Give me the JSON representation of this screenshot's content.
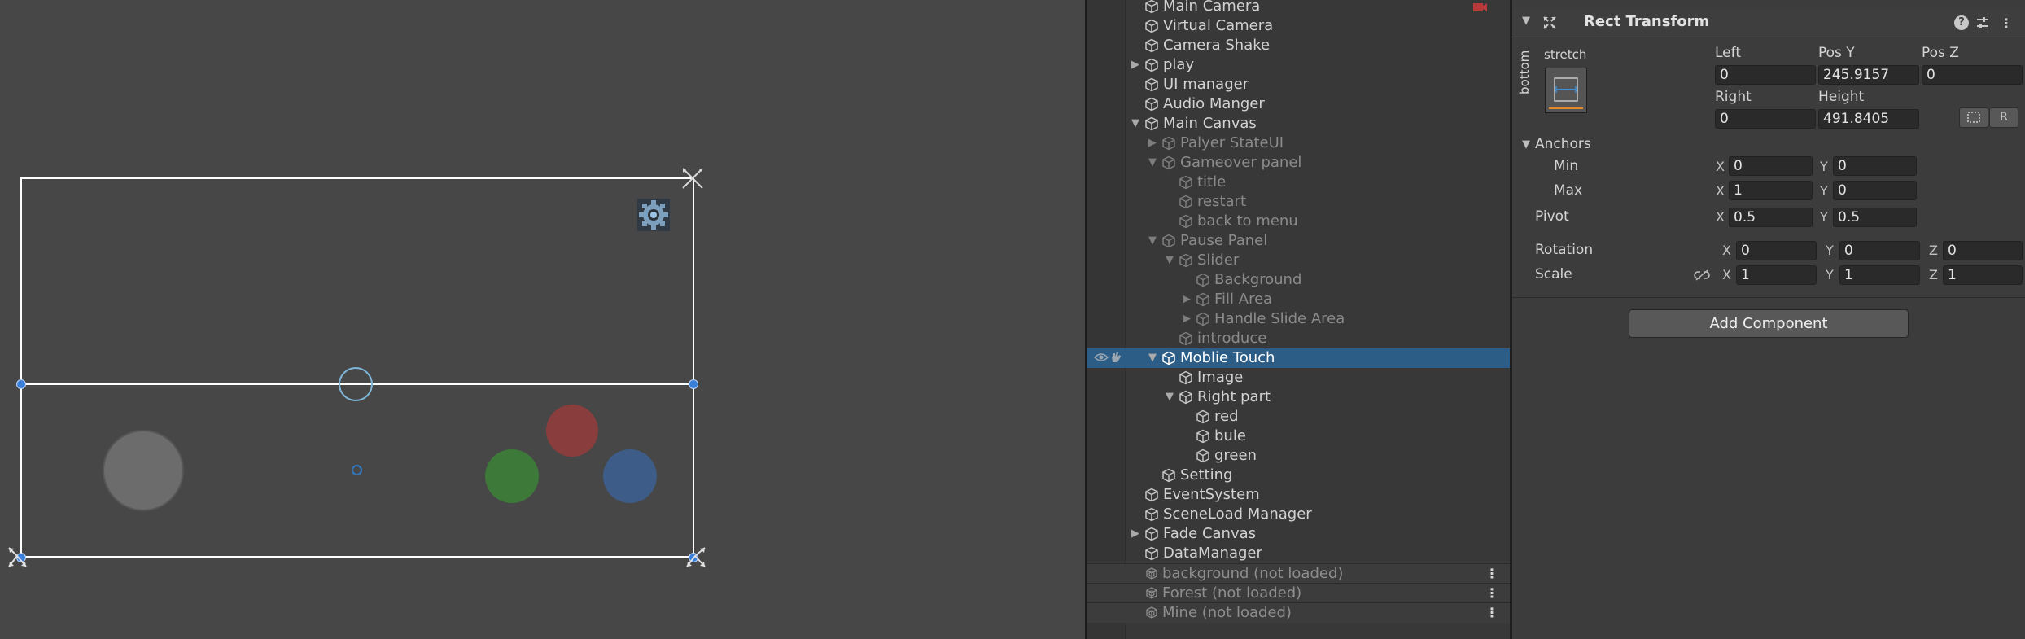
{
  "hierarchy": {
    "items": [
      {
        "label": "Main Camera",
        "depth": 0,
        "fold": "none",
        "dim": false
      },
      {
        "label": "Virtual Camera",
        "depth": 0,
        "fold": "none",
        "dim": false
      },
      {
        "label": "Camera Shake",
        "depth": 0,
        "fold": "none",
        "dim": false
      },
      {
        "label": "play",
        "depth": 0,
        "fold": "collapsed",
        "dim": false
      },
      {
        "label": "UI manager",
        "depth": 0,
        "fold": "none",
        "dim": false
      },
      {
        "label": "Audio Manger",
        "depth": 0,
        "fold": "none",
        "dim": false
      },
      {
        "label": "Main Canvas",
        "depth": 0,
        "fold": "expanded",
        "dim": false
      },
      {
        "label": "Palyer StateUI",
        "depth": 1,
        "fold": "collapsed",
        "dim": true
      },
      {
        "label": "Gameover panel",
        "depth": 1,
        "fold": "expanded",
        "dim": true
      },
      {
        "label": "title",
        "depth": 2,
        "fold": "none",
        "dim": true
      },
      {
        "label": "restart",
        "depth": 2,
        "fold": "none",
        "dim": true
      },
      {
        "label": "back to menu",
        "depth": 2,
        "fold": "none",
        "dim": true
      },
      {
        "label": "Pause Panel",
        "depth": 1,
        "fold": "expanded",
        "dim": true
      },
      {
        "label": "Slider",
        "depth": 2,
        "fold": "expanded",
        "dim": true
      },
      {
        "label": "Background",
        "depth": 3,
        "fold": "none",
        "dim": true
      },
      {
        "label": "Fill Area",
        "depth": 3,
        "fold": "collapsed",
        "dim": true
      },
      {
        "label": "Handle Slide Area",
        "depth": 3,
        "fold": "collapsed",
        "dim": true
      },
      {
        "label": "introduce",
        "depth": 2,
        "fold": "none",
        "dim": true
      },
      {
        "label": "Moblie Touch",
        "depth": 1,
        "fold": "expanded",
        "dim": false,
        "selected": true
      },
      {
        "label": "Image",
        "depth": 2,
        "fold": "none",
        "dim": false
      },
      {
        "label": "Right part",
        "depth": 2,
        "fold": "expanded",
        "dim": false
      },
      {
        "label": "red",
        "depth": 3,
        "fold": "none",
        "dim": false
      },
      {
        "label": "bule",
        "depth": 3,
        "fold": "none",
        "dim": false
      },
      {
        "label": "green",
        "depth": 3,
        "fold": "none",
        "dim": false
      },
      {
        "label": "Setting",
        "depth": 1,
        "fold": "none",
        "dim": false
      },
      {
        "label": "EventSystem",
        "depth": 0,
        "fold": "none",
        "dim": false
      },
      {
        "label": "SceneLoad Manager",
        "depth": 0,
        "fold": "none",
        "dim": false
      },
      {
        "label": "Fade Canvas",
        "depth": 0,
        "fold": "collapsed",
        "dim": false
      },
      {
        "label": "DataManager",
        "depth": 0,
        "fold": "none",
        "dim": false
      }
    ],
    "scenes": [
      {
        "label": "background (not loaded)"
      },
      {
        "label": "Forest (not loaded)"
      },
      {
        "label": "Mine (not loaded)"
      }
    ]
  },
  "inspector": {
    "component_title": "Rect Transform",
    "preset_top_label": "stretch",
    "preset_side_label": "bottom",
    "labels": {
      "left": "Left",
      "pos_y": "Pos Y",
      "pos_z": "Pos Z",
      "right": "Right",
      "height": "Height",
      "anchors": "Anchors",
      "min": "Min",
      "max": "Max",
      "pivot": "Pivot",
      "rotation": "Rotation",
      "scale": "Scale",
      "x": "X",
      "y": "Y",
      "z": "Z",
      "raw_button": "R"
    },
    "values": {
      "left": "0",
      "pos_y": "245.9157",
      "pos_z": "0",
      "right": "0",
      "height": "491.8405",
      "anchor_min_x": "0",
      "anchor_min_y": "0",
      "anchor_max_x": "1",
      "anchor_max_y": "0",
      "pivot_x": "0.5",
      "pivot_y": "0.5",
      "rotation_x": "0",
      "rotation_y": "0",
      "rotation_z": "0",
      "scale_x": "1",
      "scale_y": "1",
      "scale_z": "1"
    },
    "add_component_label": "Add Component"
  },
  "colors": {
    "selection": "#2c5d87",
    "joystick_gray": "#6e6e6e",
    "button_red": "#8a3e3e",
    "button_green": "#3d7a3a",
    "button_blue": "#3c5e8a"
  }
}
